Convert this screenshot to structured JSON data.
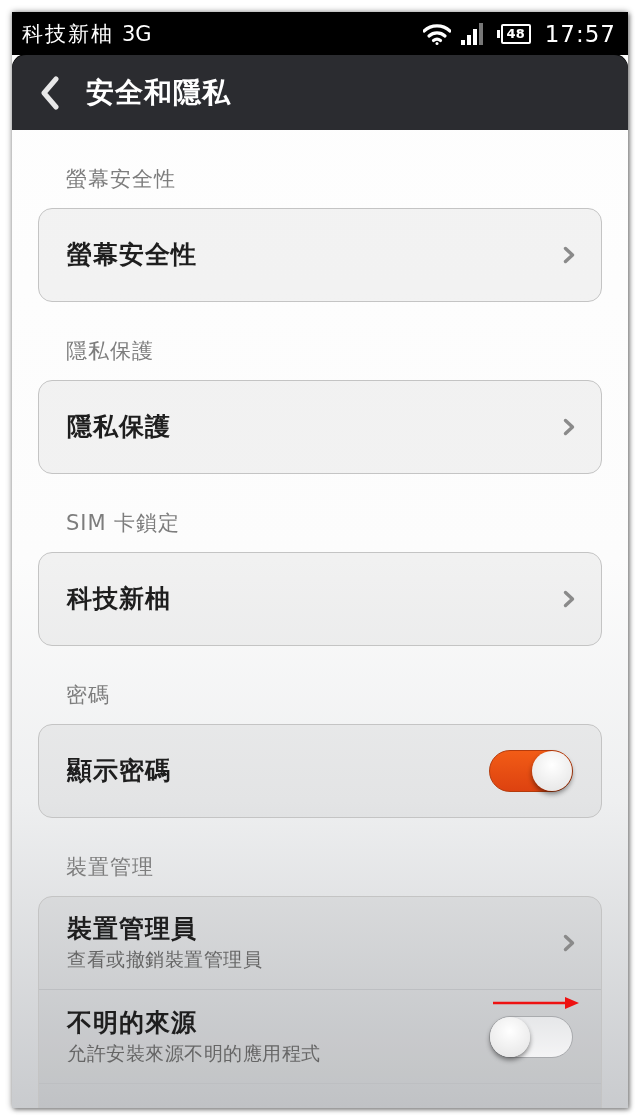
{
  "status_bar": {
    "carrier": "科技新柚",
    "network": "3G",
    "battery": "48",
    "time": "17:57"
  },
  "app_bar": {
    "title": "安全和隱私"
  },
  "sections": [
    {
      "header": "螢幕安全性",
      "items": [
        {
          "kind": "link",
          "title": "螢幕安全性"
        }
      ]
    },
    {
      "header": "隱私保護",
      "items": [
        {
          "kind": "link",
          "title": "隱私保護"
        }
      ]
    },
    {
      "header": "SIM 卡鎖定",
      "items": [
        {
          "kind": "link",
          "title": "科技新柚"
        }
      ]
    },
    {
      "header": "密碼",
      "items": [
        {
          "kind": "switch",
          "title": "顯示密碼",
          "on": true
        }
      ]
    },
    {
      "header": "裝置管理",
      "items": [
        {
          "kind": "link",
          "title": "裝置管理員",
          "subtitle": "查看或撤銷裝置管理員"
        },
        {
          "kind": "switch",
          "title": "不明的來源",
          "subtitle": "允許安裝來源不明的應用程式",
          "on": false
        },
        {
          "kind": "cut_off"
        }
      ]
    }
  ]
}
